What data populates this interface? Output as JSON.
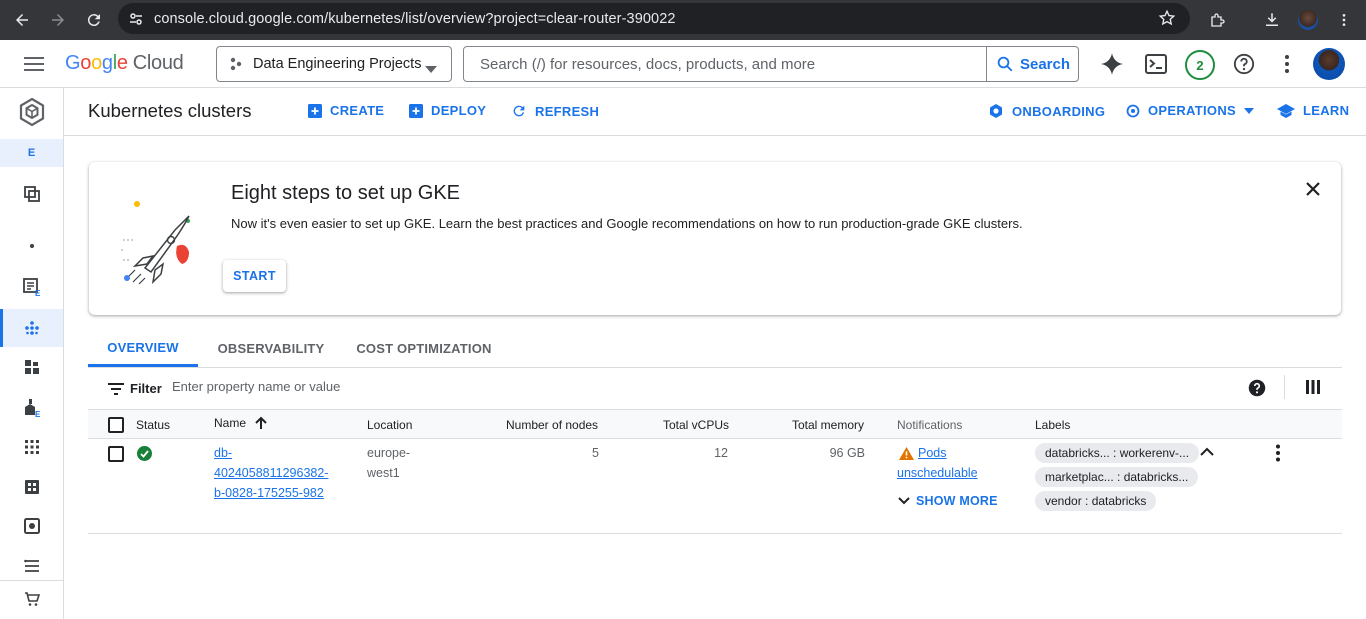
{
  "browser": {
    "url": "console.cloud.google.com/kubernetes/list/overview?project=clear-router-390022"
  },
  "header": {
    "logo_google": [
      "G",
      "o",
      "o",
      "g",
      "l",
      "e"
    ],
    "logo_cloud": "Cloud",
    "project_name": "Data Engineering Projects",
    "search_placeholder": "Search (/) for resources, docs, products, and more",
    "search_button": "Search",
    "notification_count": "2",
    "icons": [
      "hamburger-icon",
      "gemini-icon",
      "cloud-shell-icon",
      "help-icon",
      "more-vert-icon"
    ]
  },
  "left_rail": {
    "env_letter": "E",
    "items": [
      "pin-icon",
      "dot-icon",
      "overview-icon",
      "clusters-icon",
      "workloads-icon",
      "services-icon",
      "apps-icon",
      "config-icon",
      "storage-icon",
      "object-browser-icon",
      "marketplace-icon"
    ]
  },
  "toolbar": {
    "title": "Kubernetes clusters",
    "create": "CREATE",
    "deploy": "DEPLOY",
    "refresh": "REFRESH",
    "onboarding": "ONBOARDING",
    "operations": "OPERATIONS",
    "learn": "LEARN"
  },
  "banner": {
    "title": "Eight steps to set up GKE",
    "description": "Now it's even easier to set up GKE. Learn the best practices and Google recommendations on how to run production-grade GKE clusters.",
    "start": "START"
  },
  "tabs": [
    {
      "label": "OVERVIEW",
      "active": true
    },
    {
      "label": "OBSERVABILITY",
      "active": false
    },
    {
      "label": "COST OPTIMIZATION",
      "active": false
    }
  ],
  "filter": {
    "label": "Filter",
    "placeholder": "Enter property name or value"
  },
  "table": {
    "columns": {
      "status": "Status",
      "name": "Name",
      "location": "Location",
      "nodes": "Number of nodes",
      "vcpus": "Total vCPUs",
      "memory": "Total memory",
      "notifications": "Notifications",
      "labels": "Labels"
    },
    "rows": [
      {
        "status": "ok",
        "name_lines": [
          "db-",
          "4024058811296382-",
          "b-0828-175255-982"
        ],
        "location_lines": [
          "europe-",
          "west1"
        ],
        "nodes": "5",
        "vcpus": "12",
        "memory": "96 GB",
        "notification_lines": [
          "Pods",
          "unschedulable"
        ],
        "show_more": "SHOW MORE",
        "labels": [
          "databricks... : workerenv-...",
          "marketplac... : databricks...",
          "vendor : databricks"
        ]
      }
    ]
  },
  "colors": {
    "accent": "#1a73e8",
    "success": "#188038",
    "warning": "#e37400",
    "chrome_bg": "#35363a"
  }
}
